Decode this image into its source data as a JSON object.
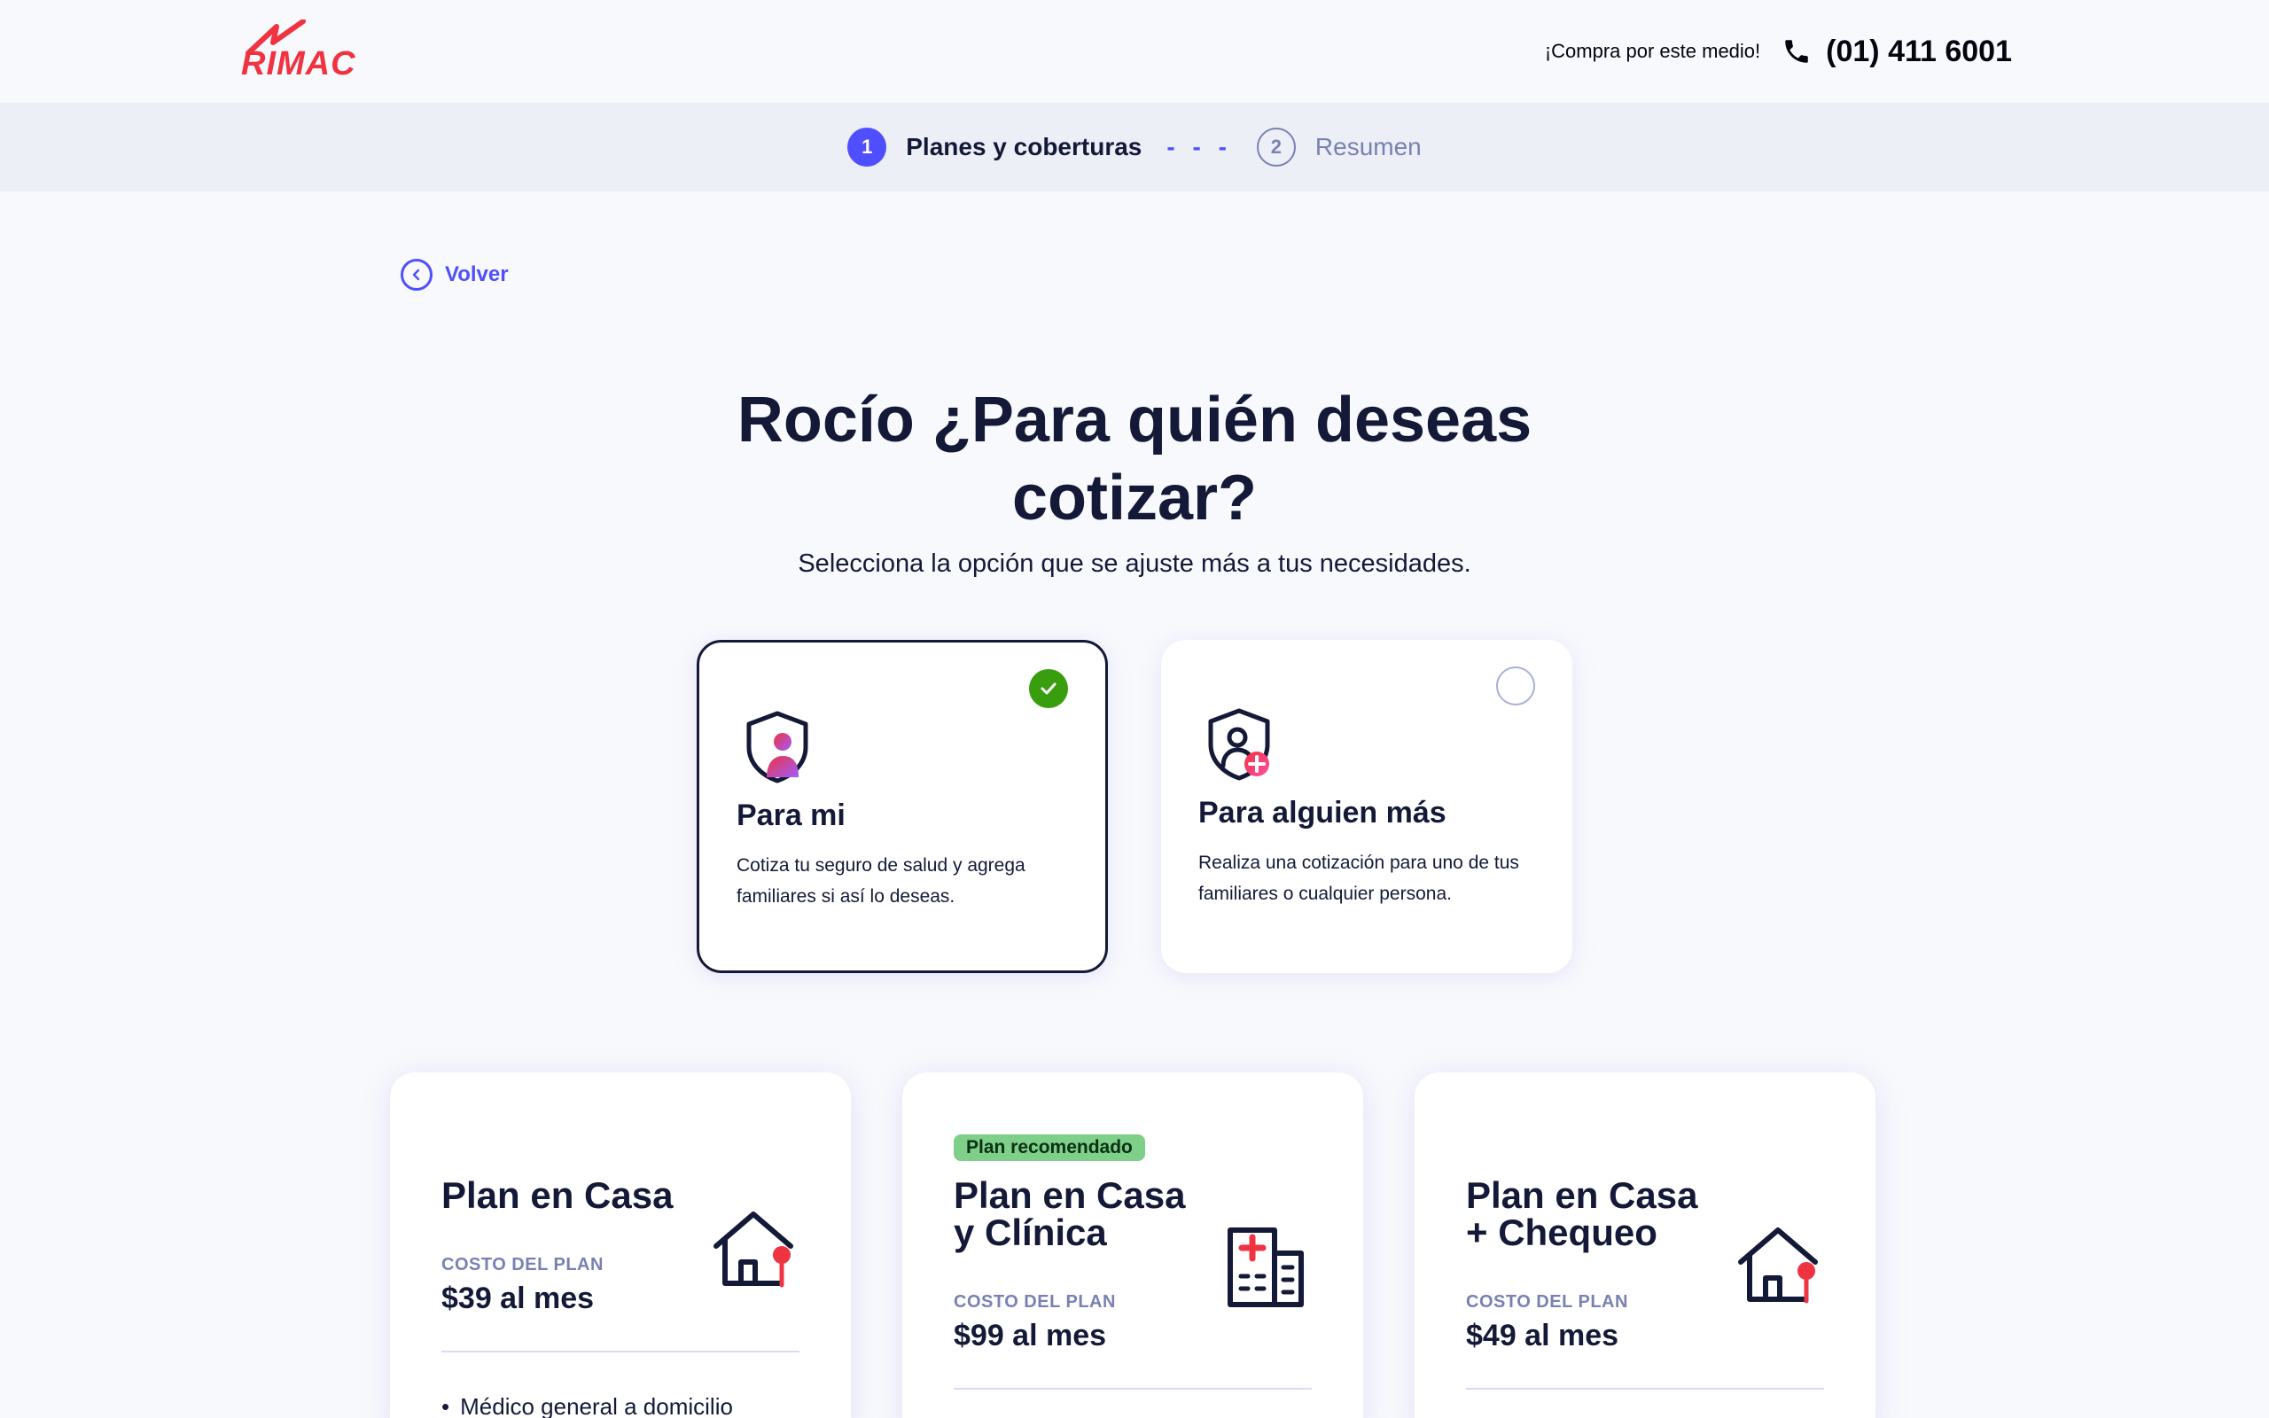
{
  "header": {
    "logo_text": "RIMAC",
    "promo": "¡Compra por este medio!",
    "phone": "(01) 411 6001"
  },
  "stepper": {
    "steps": [
      {
        "number": "1",
        "label": "Planes y coberturas"
      },
      {
        "number": "2",
        "label": "Resumen"
      }
    ],
    "separator": "- - -"
  },
  "main": {
    "back_label": "Volver",
    "title": "Rocío ¿Para quién deseas cotizar?",
    "subtitle": "Selecciona la opción que se ajuste más a tus necesidades.",
    "options": [
      {
        "title": "Para mi",
        "description": "Cotiza tu seguro de salud y agrega familiares si así lo deseas."
      },
      {
        "title": "Para alguien más",
        "description": "Realiza una cotización para uno de tus familiares o cualquier persona."
      }
    ]
  },
  "plans": [
    {
      "name": "Plan en Casa",
      "cost_label": "COSTO DEL PLAN",
      "price": "$39 al mes",
      "benefit": "Médico general a domicilio"
    },
    {
      "badge": "Plan recomendado",
      "name": "Plan en Casa y Clínica",
      "cost_label": "COSTO DEL PLAN",
      "price": "$99 al mes"
    },
    {
      "name": "Plan en Casa + Chequeo",
      "cost_label": "COSTO DEL PLAN",
      "price": "$49 al mes"
    }
  ],
  "colors": {
    "brand_red": "#ef3340",
    "accent_blue": "#4f4fff",
    "check_green": "#389e0d",
    "badge_green": "#7dcf8a",
    "text_dark": "#141938",
    "text_muted": "#7981b2"
  }
}
